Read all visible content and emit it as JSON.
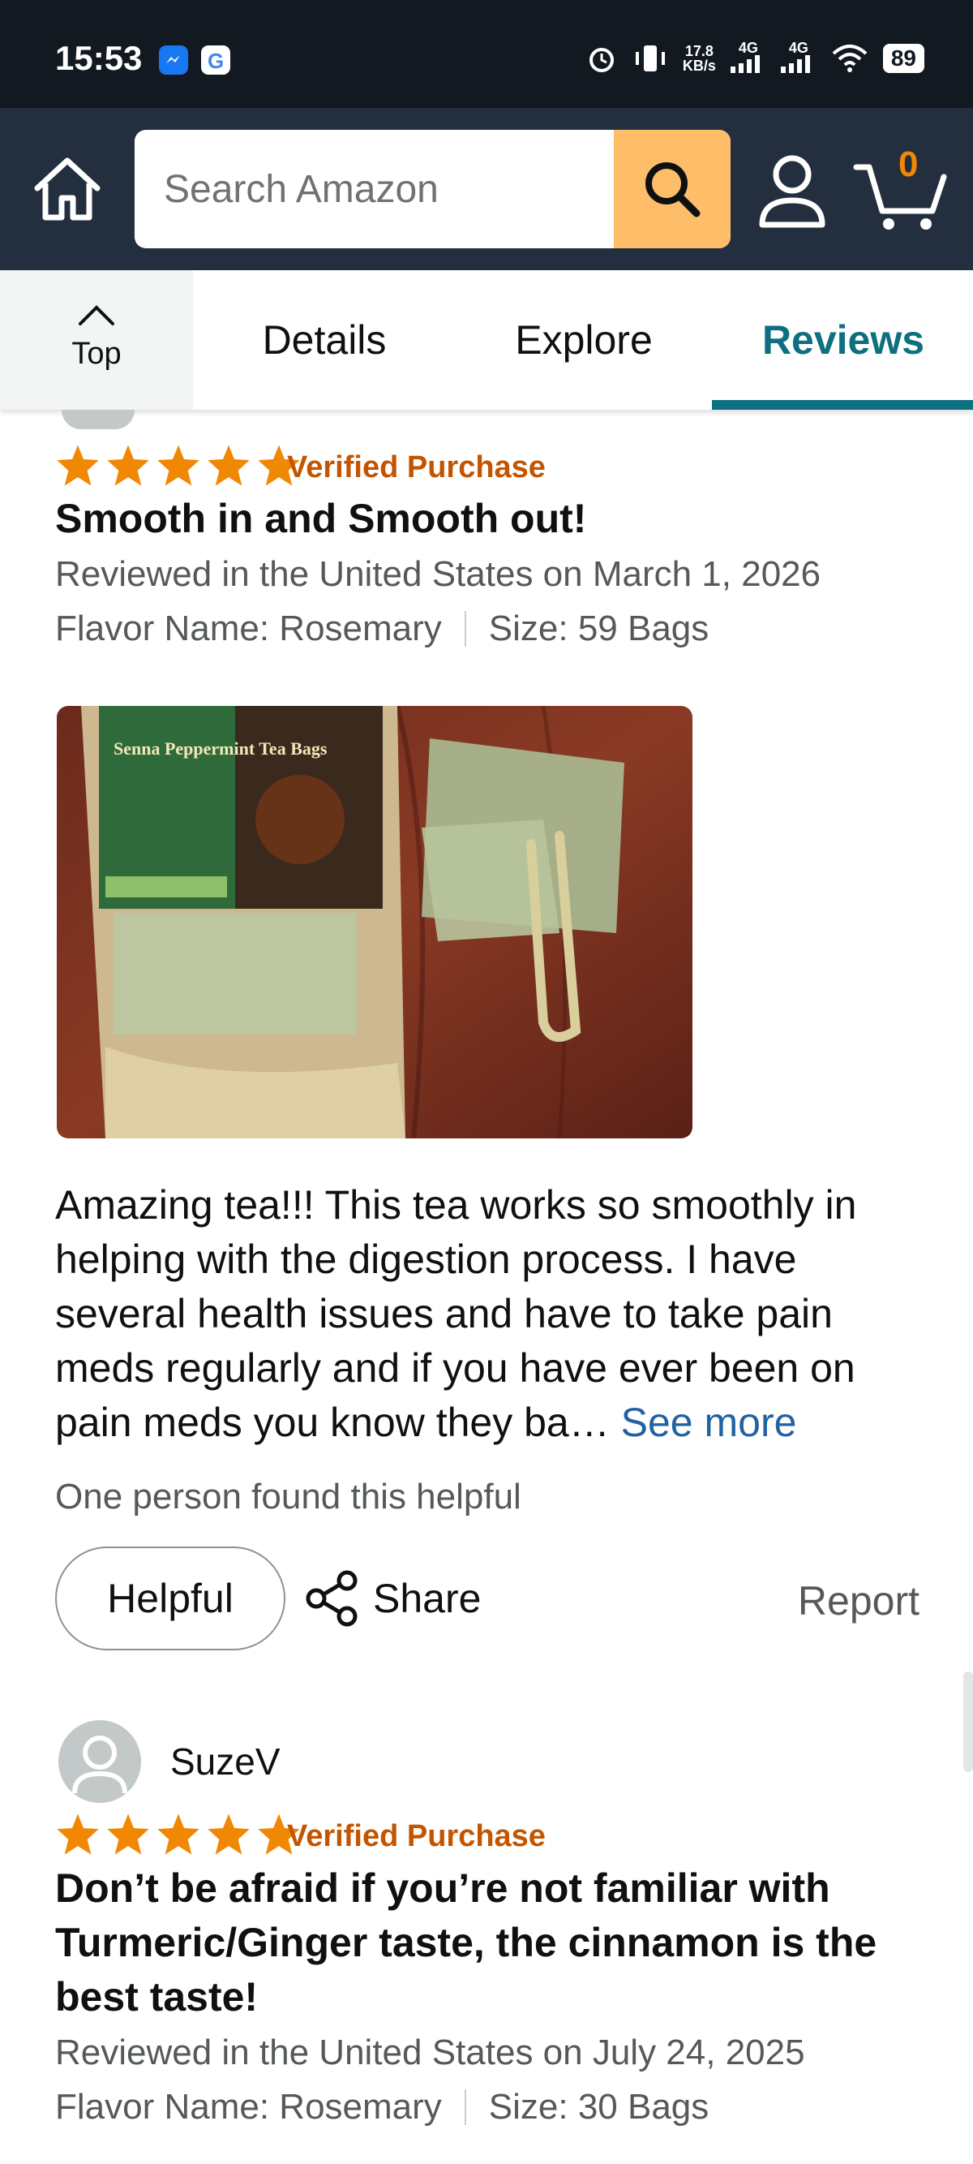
{
  "status_bar": {
    "time": "15:53",
    "net_speed_top": "17.8",
    "net_speed_bottom": "KB/s",
    "signal1": "4G",
    "signal2": "4G",
    "battery": "89"
  },
  "header": {
    "search_placeholder": "Search Amazon",
    "cart_count": "0",
    "accent_color": "#febd69",
    "bg_color": "#232f3e"
  },
  "tabs": {
    "top_label": "Top",
    "items": [
      {
        "label": "Details"
      },
      {
        "label": "Explore"
      },
      {
        "label": "Reviews"
      }
    ],
    "active": "Reviews",
    "active_color": "#0d6f7f"
  },
  "reviews": [
    {
      "rating": 5,
      "verified": "Verified Purchase",
      "title": "Smooth in and Smooth out!",
      "date_line": "Reviewed in the United States on March 1, 2026",
      "flavor": "Flavor Name: Rosemary",
      "size": "Size: 59 Bags",
      "photo_label": "Senna Peppermint Tea Bags",
      "body": "Amazing tea!!! This tea works so smoothly in helping with the digestion process. I have several health issues and have to take pain meds regularly and if you have ever been on pain meds you know they ba…",
      "see_more": "See more",
      "helpful_count": "One person found this helpful",
      "helpful_label": "Helpful",
      "share_label": "Share",
      "report_label": "Report"
    },
    {
      "reviewer": "SuzeV",
      "rating": 5,
      "verified": "Verified Purchase",
      "title": "Don’t be afraid if you’re not familiar with Turmeric/Ginger taste, the cinnamon is the best taste!",
      "date_line": "Reviewed in the United States on July 24, 2025",
      "flavor": "Flavor Name: Rosemary",
      "size": "Size: 30 Bags"
    }
  ],
  "colors": {
    "star": "#f08804",
    "verified": "#c45500",
    "link": "#2162a1"
  }
}
